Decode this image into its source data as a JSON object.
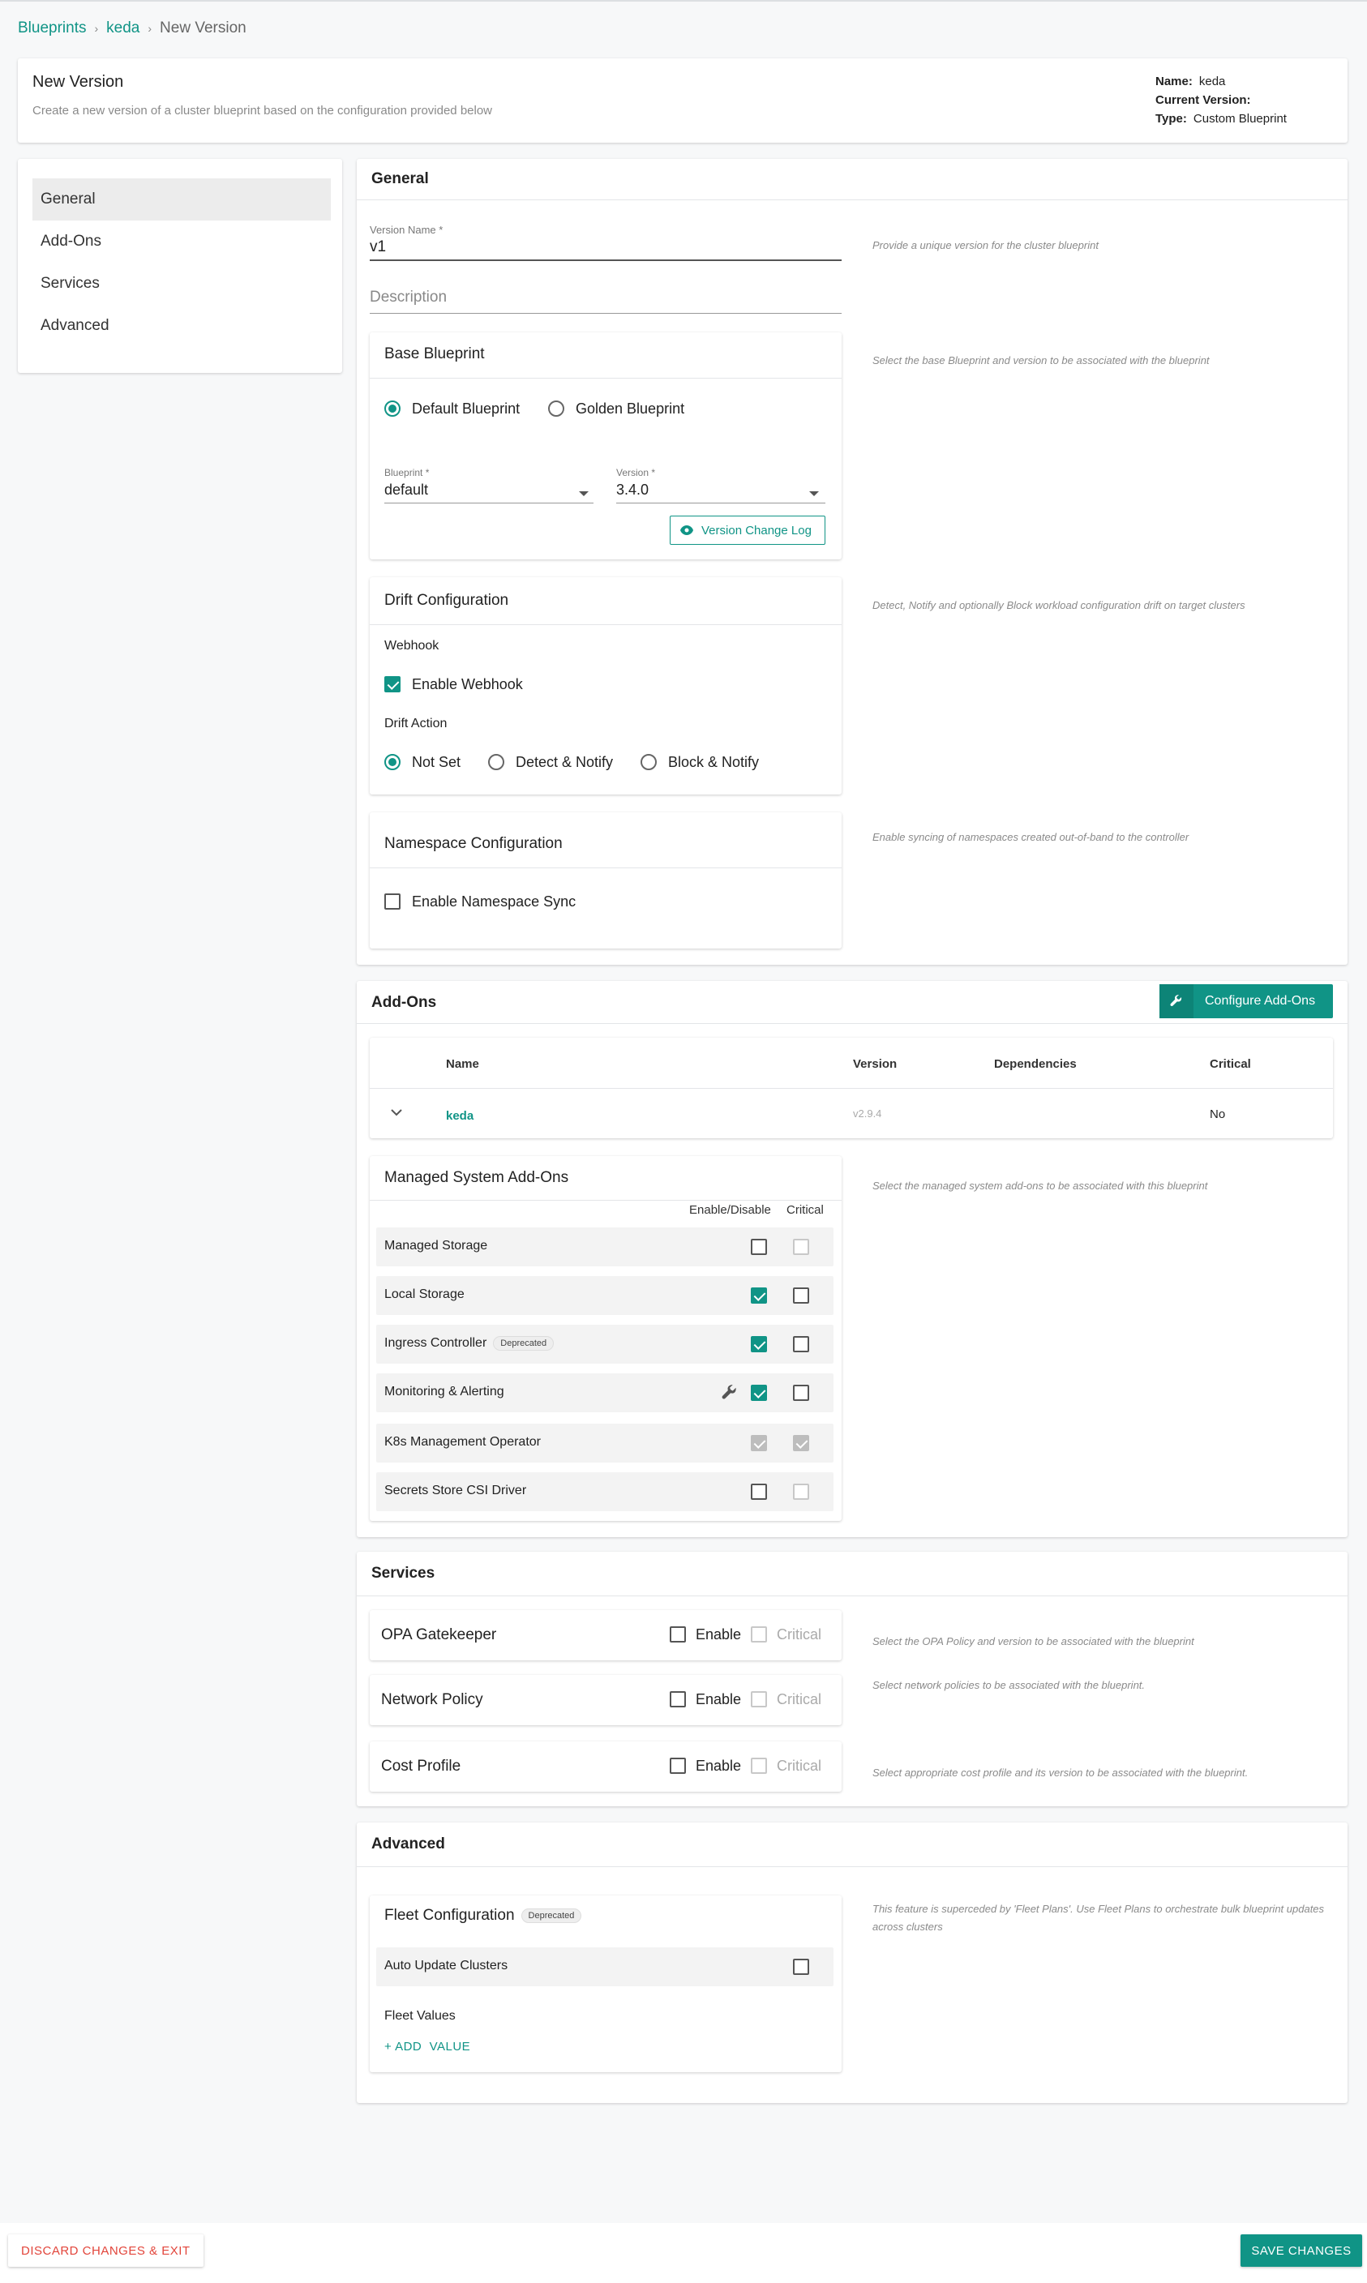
{
  "breadcrumb": {
    "items": [
      "Blueprints",
      "keda"
    ],
    "current": "New Version"
  },
  "header": {
    "title": "New Version",
    "subtitle": "Create a new version of a cluster blueprint based on the configuration provided below",
    "meta": [
      {
        "key": "Name:",
        "value": "keda"
      },
      {
        "key": "Current Version:",
        "value": ""
      },
      {
        "key": "Type:",
        "value": "Custom Blueprint"
      }
    ]
  },
  "sidebar": {
    "items": [
      {
        "label": "General",
        "active": true
      },
      {
        "label": "Add-Ons",
        "active": false
      },
      {
        "label": "Services",
        "active": false
      },
      {
        "label": "Advanced",
        "active": false
      }
    ]
  },
  "general": {
    "title": "General",
    "version_name_label": "Version Name *",
    "version_name_value": "v1",
    "version_hint": "Provide a unique version for the cluster blueprint",
    "description_placeholder": "Description",
    "base": {
      "title": "Base Blueprint",
      "hint": "Select the base Blueprint and version to be associated with the blueprint",
      "option_default": "Default Blueprint",
      "option_golden": "Golden Blueprint",
      "selected": "default",
      "blueprint_label": "Blueprint *",
      "blueprint_value": "default",
      "version_label": "Version *",
      "version_value": "3.4.0",
      "changelog_button": "Version Change Log"
    },
    "drift": {
      "title": "Drift Configuration",
      "hint": "Detect, Notify and optionally Block workload configuration drift on target clusters",
      "webhook_label": "Webhook",
      "enable_webhook": "Enable Webhook",
      "webhook_enabled": true,
      "action_label": "Drift Action",
      "actions": [
        "Not Set",
        "Detect & Notify",
        "Block & Notify"
      ],
      "selected_action": "Not Set"
    },
    "namespace": {
      "title": "Namespace Configuration",
      "hint": "Enable syncing of namespaces created out-of-band to the controller",
      "enable_sync": "Enable Namespace Sync",
      "sync_enabled": false
    }
  },
  "addons": {
    "title": "Add-Ons",
    "configure_button": "Configure Add-Ons",
    "columns": [
      "Name",
      "Version",
      "Dependencies",
      "Critical"
    ],
    "rows": [
      {
        "name": "keda",
        "version": "v2.9.4",
        "dependencies": "",
        "critical": "No"
      }
    ],
    "managed": {
      "title": "Managed System Add-Ons",
      "hint": "Select the managed system add-ons to be associated with this blueprint",
      "col_enable": "Enable/Disable",
      "col_critical": "Critical",
      "deprecated_badge": "Deprecated",
      "items": [
        {
          "label": "Managed Storage",
          "enabled": false,
          "critical": false
        },
        {
          "label": "Local Storage",
          "enabled": true,
          "critical": false
        },
        {
          "label": "Ingress Controller",
          "enabled": true,
          "critical": false
        },
        {
          "label": "Monitoring & Alerting",
          "enabled": true,
          "critical": false
        },
        {
          "label": "K8s Management Operator",
          "enabled": true,
          "critical": true
        },
        {
          "label": "Secrets Store CSI Driver",
          "enabled": false,
          "critical": false
        }
      ]
    }
  },
  "services": {
    "title": "Services",
    "enable_label": "Enable",
    "critical_label": "Critical",
    "items": [
      {
        "title": "OPA Gatekeeper",
        "hint": "Select the OPA Policy and version to be associated with the blueprint"
      },
      {
        "title": "Network Policy",
        "hint": "Select network policies to be associated with the blueprint."
      },
      {
        "title": "Cost Profile",
        "hint": "Select appropriate cost profile and its version to be associated with the blueprint."
      }
    ]
  },
  "advanced": {
    "title": "Advanced",
    "fleet": {
      "title": "Fleet Configuration",
      "badge": "Deprecated",
      "hint": "This feature is superceded by 'Fleet Plans'. Use Fleet Plans to orchestrate bulk blueprint updates across clusters",
      "auto_update": "Auto Update Clusters",
      "auto_update_enabled": false,
      "values_label": "Fleet Values",
      "add_value": "+ ADD  VALUE"
    }
  },
  "footer": {
    "discard": "DISCARD CHANGES & EXIT",
    "save": "SAVE CHANGES"
  },
  "colors": {
    "accent": "#109486",
    "danger": "#e2453b"
  }
}
